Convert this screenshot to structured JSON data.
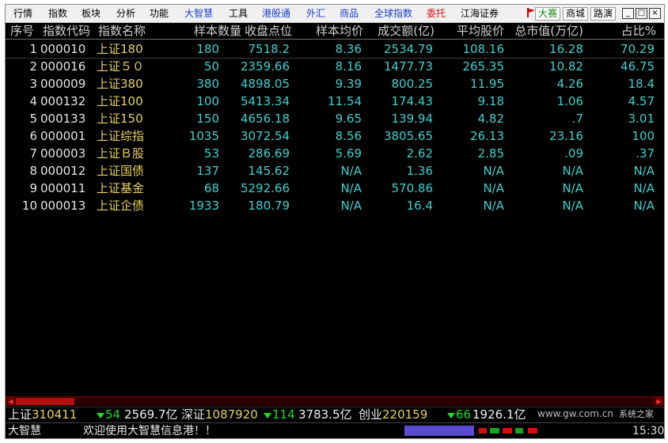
{
  "menubar": {
    "items": [
      "行情",
      "指数",
      "板块",
      "分析",
      "功能",
      "大智慧",
      "工具",
      "港股通",
      "外汇",
      "商品",
      "全球指数",
      "委托",
      "江海证券"
    ],
    "buttons": [
      "大赛",
      "商城",
      "路演"
    ],
    "window_controls": [
      "_",
      "□",
      "×"
    ]
  },
  "grid": {
    "headers": [
      "序号",
      "指数代码",
      "指数名称",
      "样本数量",
      "收盘点位",
      "样本均价",
      "成交额(亿)",
      "平均股价",
      "总市值(万亿)",
      "占比%"
    ],
    "rows": [
      {
        "no": "1",
        "code": "000010",
        "name": "上证180",
        "count": "180",
        "close": "7518.2",
        "avg": "8.36",
        "turnover": "2534.79",
        "avg_price": "108.16",
        "mkt_cap": "16.28",
        "share": "70.29"
      },
      {
        "no": "2",
        "code": "000016",
        "name": "上证５０",
        "count": "50",
        "close": "2359.66",
        "avg": "8.16",
        "turnover": "1477.73",
        "avg_price": "265.35",
        "mkt_cap": "10.82",
        "share": "46.75"
      },
      {
        "no": "3",
        "code": "000009",
        "name": "上证380",
        "count": "380",
        "close": "4898.05",
        "avg": "9.39",
        "turnover": "800.25",
        "avg_price": "11.95",
        "mkt_cap": "4.26",
        "share": "18.4"
      },
      {
        "no": "4",
        "code": "000132",
        "name": "上证100",
        "count": "100",
        "close": "5413.34",
        "avg": "11.54",
        "turnover": "174.43",
        "avg_price": "9.18",
        "mkt_cap": "1.06",
        "share": "4.57"
      },
      {
        "no": "5",
        "code": "000133",
        "name": "上证150",
        "count": "150",
        "close": "4656.18",
        "avg": "9.65",
        "turnover": "139.94",
        "avg_price": "4.82",
        "mkt_cap": ".7",
        "share": "3.01"
      },
      {
        "no": "6",
        "code": "000001",
        "name": "上证综指",
        "count": "1035",
        "close": "3072.54",
        "avg": "8.56",
        "turnover": "3805.65",
        "avg_price": "26.13",
        "mkt_cap": "23.16",
        "share": "100"
      },
      {
        "no": "7",
        "code": "000003",
        "name": "上证Ｂ股",
        "count": "53",
        "close": "286.69",
        "avg": "5.69",
        "turnover": "2.62",
        "avg_price": "2.85",
        "mkt_cap": ".09",
        "share": ".37"
      },
      {
        "no": "8",
        "code": "000012",
        "name": "上证国债",
        "count": "137",
        "close": "145.62",
        "avg": "N/A",
        "turnover": "1.36",
        "avg_price": "N/A",
        "mkt_cap": "N/A",
        "share": "N/A"
      },
      {
        "no": "9",
        "code": "000011",
        "name": "上证基金",
        "count": "68",
        "close": "5292.66",
        "avg": "N/A",
        "turnover": "570.86",
        "avg_price": "N/A",
        "mkt_cap": "N/A",
        "share": "N/A"
      },
      {
        "no": "10",
        "code": "000013",
        "name": "上证企债",
        "count": "1933",
        "close": "180.79",
        "avg": "N/A",
        "turnover": "16.4",
        "avg_price": "N/A",
        "mkt_cap": "N/A",
        "share": "N/A"
      }
    ]
  },
  "ticker": [
    {
      "label": "上证",
      "value": "310411",
      "change": "54",
      "amount": "2569.7亿"
    },
    {
      "label": "深证",
      "value": "1087920",
      "change": "114",
      "amount": "3783.5亿"
    },
    {
      "label": "创业",
      "value": "220159",
      "change": "66",
      "amount": "1926.1亿"
    }
  ],
  "status": {
    "app": "大智慧",
    "message": "欢迎使用大智慧信息港！！",
    "time": "15:30"
  },
  "watermark": {
    "url": "www.gw.com.cn",
    "site": "系统之家"
  },
  "colors": {
    "background": "#000000",
    "header_text": "#cfcfcf",
    "index_name": "#e8d060",
    "values": "#3fd0d0",
    "down": "#22dd22",
    "scroll": "#b01010"
  }
}
